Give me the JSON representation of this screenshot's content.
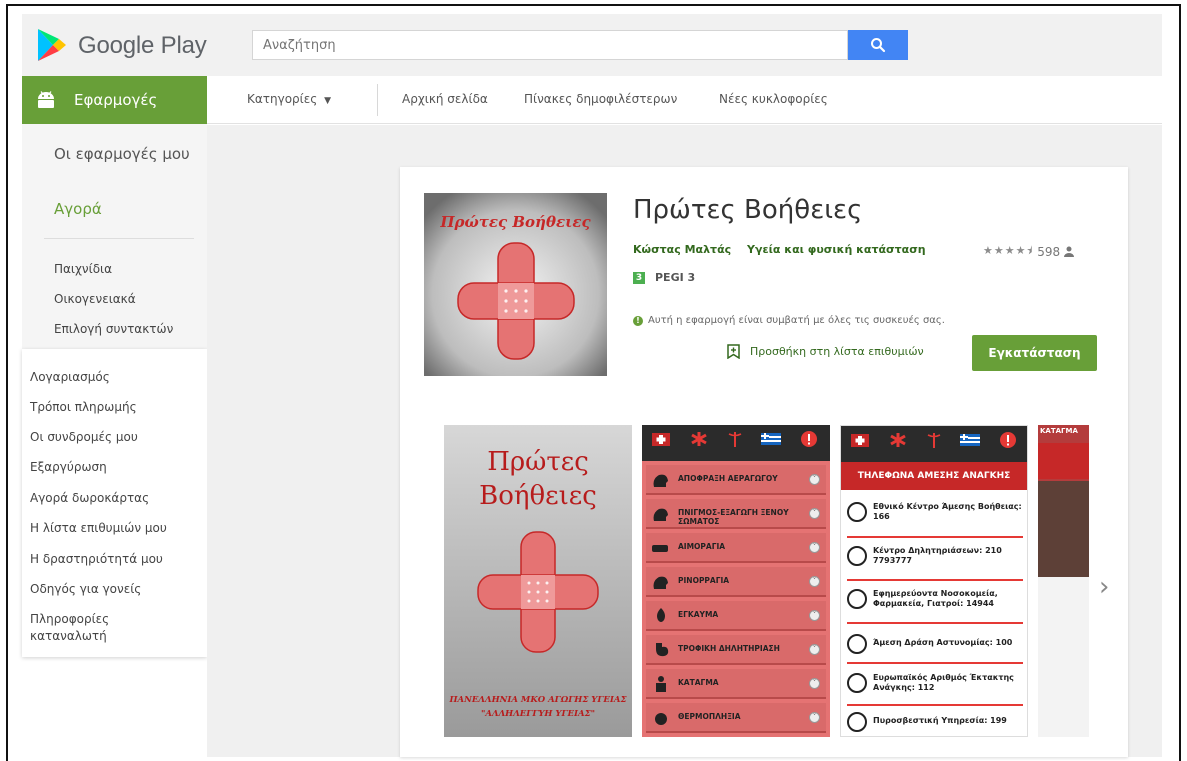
{
  "header": {
    "logo_text": "Google Play",
    "search_placeholder": "Αναζήτηση"
  },
  "apps_tab": {
    "label": "Εφαρμογές"
  },
  "nav": {
    "categories": "Κατηγορίες",
    "home": "Αρχική σελίδα",
    "top_charts": "Πίνακες δημοφιλέστερων",
    "new_releases": "Νέες κυκλοφορίες"
  },
  "sidebar": {
    "my_apps": "Οι εφαρμογές μου",
    "shop": "Αγορά",
    "sub_items": [
      "Παιχνίδια",
      "Οικογενειακά",
      "Επιλογή συντακτών"
    ],
    "account_items": [
      "Λογαριασμός",
      "Τρόποι πληρωμής",
      "Οι συνδρομές μου",
      "Εξαργύρωση",
      "Αγορά δωροκάρτας",
      "Η λίστα επιθυμιών μου",
      "Η δραστηριότητά μου",
      "Οδηγός για γονείς",
      "Πληροφορίες καταναλωτή"
    ]
  },
  "app": {
    "icon_text": "Πρώτες Βοήθειες",
    "title": "Πρώτες Βοήθειες",
    "developer": "Κώστας Μαλτάς",
    "category": "Υγεία και φυσική κατάσταση",
    "rating_stars": 4.5,
    "rating_count": "598",
    "pegi_badge": "3",
    "pegi": "PEGI 3",
    "compatibility": "Αυτή η εφαρμογή είναι συμβατή με όλες τις συσκευές σας.",
    "wishlist": "Προσθήκη στη λίστα επιθυμιών",
    "install": "Εγκατάσταση"
  },
  "screenshots": {
    "shot1": {
      "title_line1": "Πρώτες",
      "title_line2": "Βοήθειες",
      "footer_line1": "ΠΑΝΕΛΛΗΝΙΑ ΜΚΟ ΑΓΩΓΗΣ ΥΓΕΙΑΣ",
      "footer_line2": "\"ΑΛΛΗΛΕΓΓΥΗ ΥΓΕΙΑΣ\""
    },
    "shot2_rows": [
      "ΑΠΟΦΡΑΞΗ ΑΕΡΑΓΩΓΟΥ",
      "ΠΝΙΓΜΟΣ-ΕΞΑΓΩΓΗ ΞΕΝΟΥ ΣΩΜΑΤΟΣ",
      "ΑΙΜΟΡΑΓΙΑ",
      "ΡΙΝΟΡΡΑΓΙΑ",
      "ΕΓΚΑΥΜΑ",
      "ΤΡΟΦΙΚΗ ΔΗΛΗΤΗΡΙΑΣΗ",
      "ΚΑΤΑΓΜΑ",
      "ΘΕΡΜΟΠΛΗΞΙΑ"
    ],
    "shot3_header": "ΤΗΛΕΦΩΝΑ ΑΜΕΣΗΣ ΑΝΑΓΚΗΣ",
    "shot3_rows": [
      "Εθνικό Κέντρο Άμεσης Βοήθειας: 166",
      "Κέντρο Δηλητηριάσεων: 210 7793777",
      "Εφημερεύοντα Νοσοκομεία, Φαρμακεία, Γιατροί: 14944",
      "Άμεση Δράση Αστυνομίας: 100",
      "Ευρωπαϊκός Αριθμός Έκτακτης Ανάγκης: 112",
      "Πυροσβεστική Υπηρεσία: 199"
    ],
    "shot4_header": "ΚΑΤΑΓΜΑ"
  },
  "colors": {
    "play_green": "#689f38",
    "search_blue": "#4285f4",
    "dark_green_text": "#33691e",
    "emergency_red": "#c62828"
  }
}
